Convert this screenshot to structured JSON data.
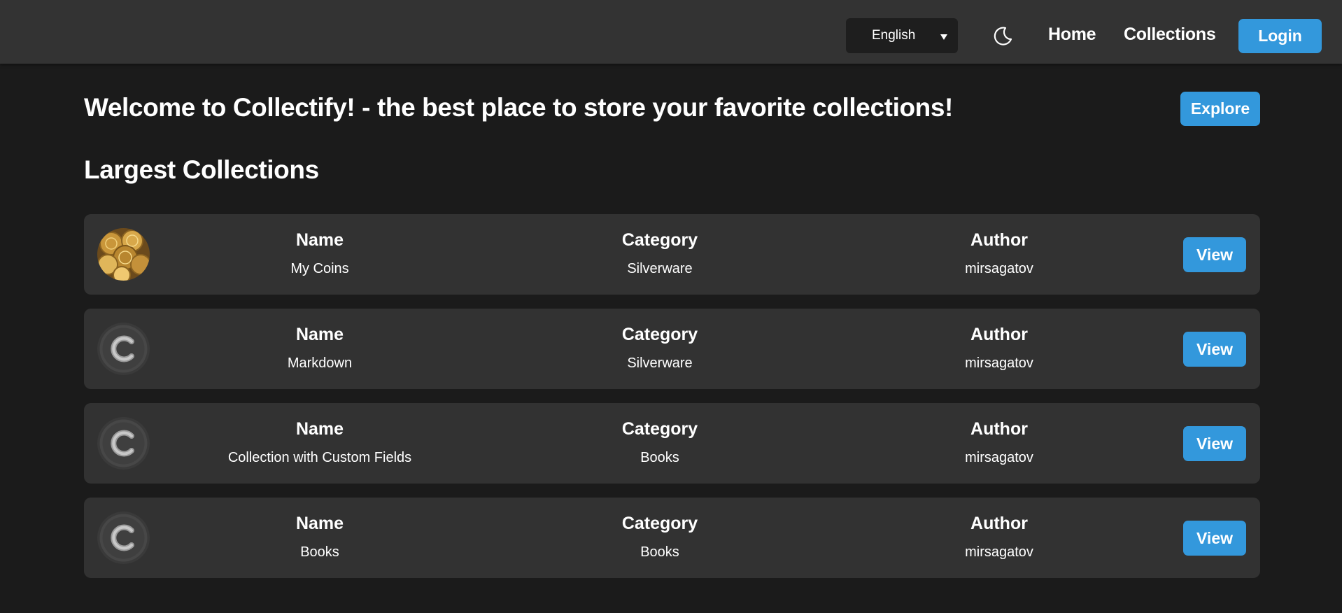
{
  "navbar": {
    "language": {
      "selected": "English",
      "caret": "▼"
    },
    "theme_toggle_icon": "moon-icon",
    "links": {
      "home": "Home",
      "collections": "Collections"
    },
    "login_label": "Login"
  },
  "hero": {
    "welcome": "Welcome to Collectify! - the best place to store your favorite collections!",
    "explore_label": "Explore"
  },
  "largest": {
    "title": "Largest Collections",
    "field_labels": {
      "name": "Name",
      "category": "Category",
      "author": "Author"
    },
    "view_label": "View",
    "items": [
      {
        "image": "coins",
        "name": "My Coins",
        "category": "Silverware",
        "author": "mirsagatov"
      },
      {
        "image": "placeholder-c",
        "name": "Markdown",
        "category": "Silverware",
        "author": "mirsagatov"
      },
      {
        "image": "placeholder-c",
        "name": "Collection with Custom Fields",
        "category": "Books",
        "author": "mirsagatov"
      },
      {
        "image": "placeholder-c",
        "name": "Books",
        "category": "Books",
        "author": "mirsagatov"
      }
    ]
  },
  "colors": {
    "accent": "#3398dc",
    "background": "#1b1b1b",
    "navbar": "#333333",
    "card": "#323232"
  }
}
